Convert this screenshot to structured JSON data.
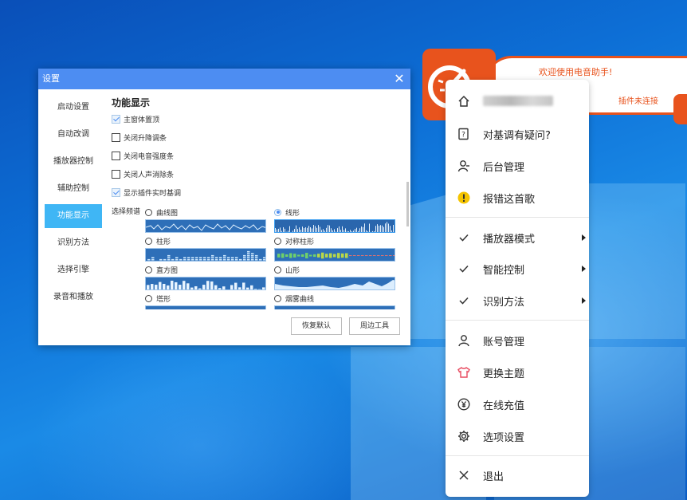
{
  "dialog": {
    "title": "设置",
    "sidebar": {
      "items": [
        {
          "label": "启动设置",
          "active": false
        },
        {
          "label": "自动改调",
          "active": false
        },
        {
          "label": "播放器控制",
          "active": false
        },
        {
          "label": "辅助控制",
          "active": false
        },
        {
          "label": "功能显示",
          "active": true
        },
        {
          "label": "识别方法",
          "active": false
        },
        {
          "label": "选择引擎",
          "active": false
        },
        {
          "label": "录音和播放",
          "active": false
        }
      ]
    },
    "section_title": "功能显示",
    "checkboxes": [
      {
        "label": "主窗体置顶",
        "checked": true
      },
      {
        "label": "关闭升降调条",
        "checked": false
      },
      {
        "label": "关闭电音强度条",
        "checked": false
      },
      {
        "label": "关闭人声消除条",
        "checked": false
      },
      {
        "label": "显示插件实时基调",
        "checked": true
      }
    ],
    "spectrum_label": "选择频谱",
    "spectrum_options": [
      {
        "label": "曲线图",
        "selected": false
      },
      {
        "label": "线形",
        "selected": true
      },
      {
        "label": "柱形",
        "selected": false
      },
      {
        "label": "对称柱形",
        "selected": false
      },
      {
        "label": "直方图",
        "selected": false
      },
      {
        "label": "山形",
        "selected": false
      },
      {
        "label": "塔形",
        "selected": false
      },
      {
        "label": "烟雾曲线",
        "selected": false
      }
    ],
    "buttons": {
      "restore_default": "恢复默认",
      "tools": "周边工具"
    }
  },
  "assistant": {
    "welcome_text": "欢迎使用电音助手!",
    "status_text": "插件未连接",
    "accent_color": "#e8531d"
  },
  "menu": {
    "items": [
      {
        "icon": "home-icon",
        "label": "",
        "has_submenu": false,
        "redacted": true
      },
      {
        "icon": "question-document-icon",
        "label": "对基调有疑问?",
        "has_submenu": false
      },
      {
        "icon": "admin-user-icon",
        "label": "后台管理",
        "has_submenu": false
      },
      {
        "icon": "warning-icon",
        "label": "报错这首歌",
        "has_submenu": false
      },
      {
        "icon": "check-icon",
        "label": "播放器模式",
        "has_submenu": true
      },
      {
        "icon": "check-icon",
        "label": "智能控制",
        "has_submenu": true
      },
      {
        "icon": "check-icon",
        "label": "识别方法",
        "has_submenu": true
      },
      {
        "icon": "user-icon",
        "label": "账号管理",
        "has_submenu": false
      },
      {
        "icon": "shirt-icon",
        "label": "更换主题",
        "has_submenu": false
      },
      {
        "icon": "yen-coin-icon",
        "label": "在线充值",
        "has_submenu": false
      },
      {
        "icon": "gear-icon",
        "label": "选项设置",
        "has_submenu": false
      },
      {
        "icon": "close-icon",
        "label": "退出",
        "has_submenu": false
      }
    ]
  }
}
